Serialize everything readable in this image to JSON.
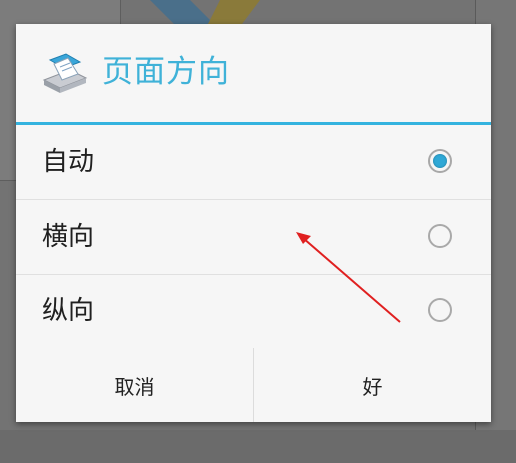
{
  "dialog": {
    "title": "页面方向",
    "icon": "printer-icon",
    "accent_color": "#34b3df",
    "options": [
      {
        "label": "自动",
        "selected": true
      },
      {
        "label": "横向",
        "selected": false
      },
      {
        "label": "纵向",
        "selected": false
      }
    ],
    "buttons": {
      "cancel_label": "取消",
      "ok_label": "好"
    }
  },
  "annotation": {
    "arrow_color": "#e02020",
    "arrow_target": "横向"
  }
}
